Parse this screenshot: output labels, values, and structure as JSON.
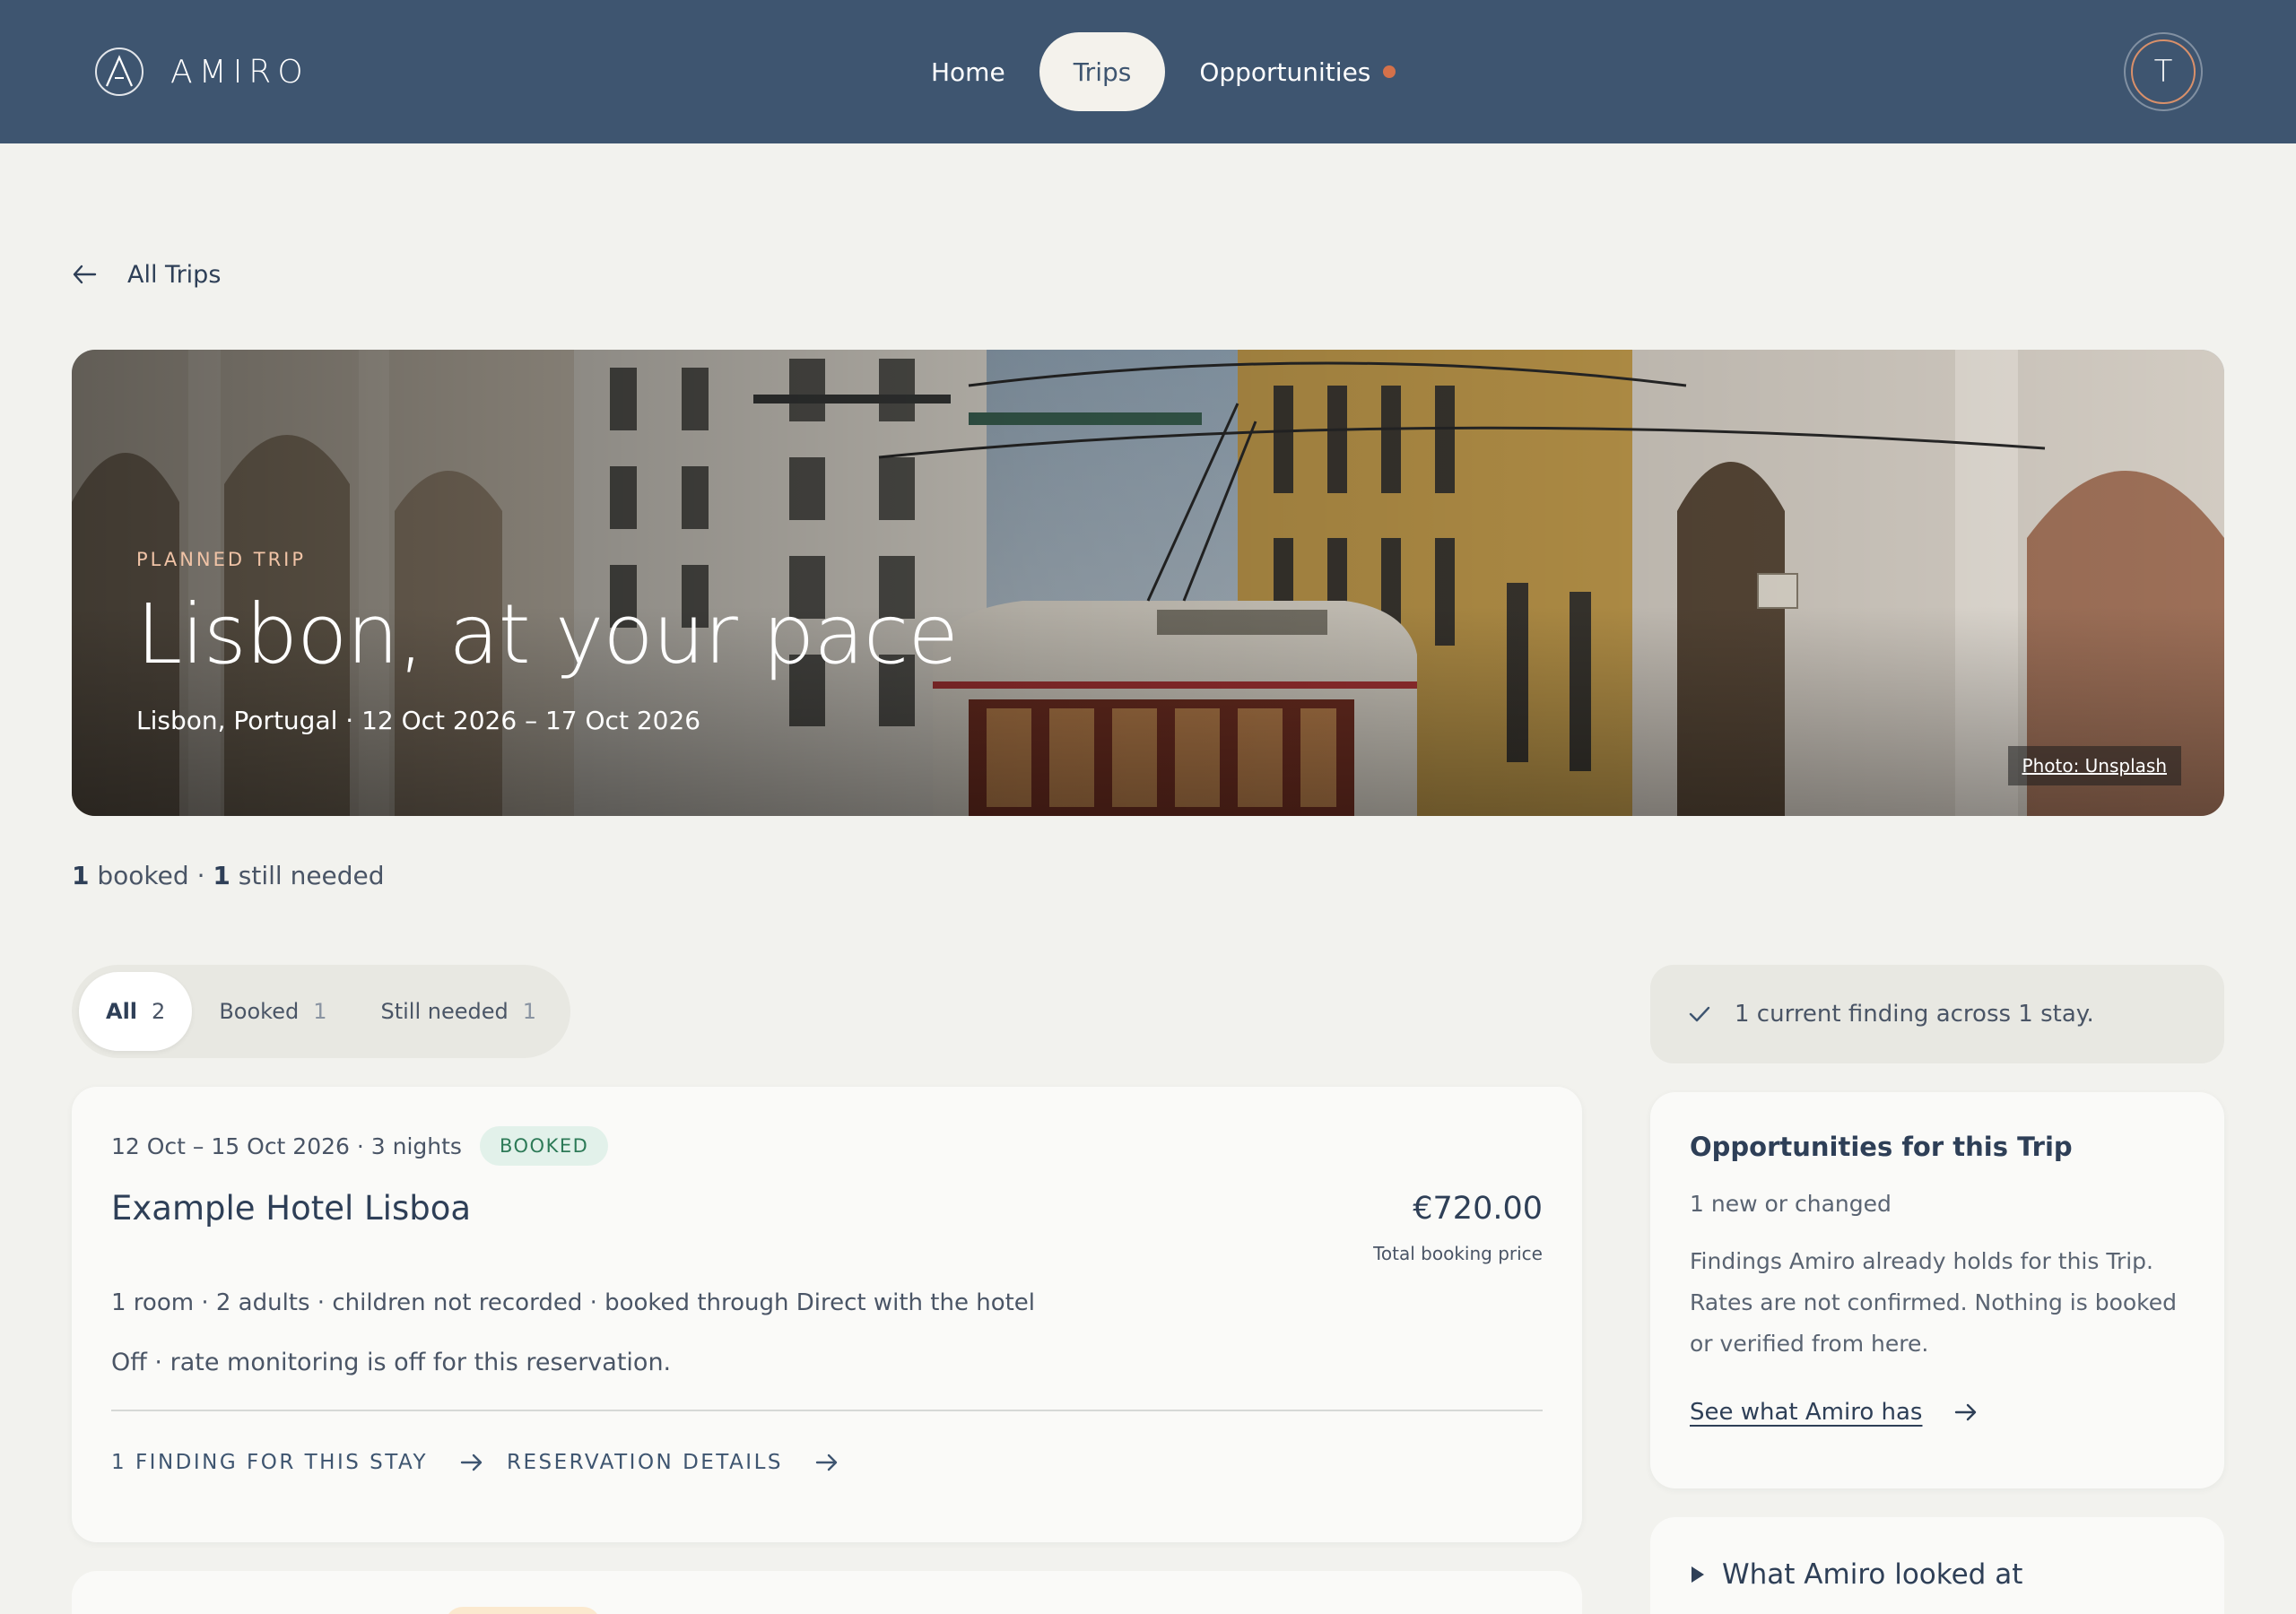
{
  "brand": {
    "name": "AMIRO"
  },
  "nav": {
    "items": [
      {
        "label": "Home",
        "active": false
      },
      {
        "label": "Trips",
        "active": true
      },
      {
        "label": "Opportunities",
        "active": false,
        "has_notification": true
      }
    ],
    "notification_color": "#d4714a"
  },
  "user": {
    "initial": "T"
  },
  "back": {
    "label": "All Trips",
    "icon": "arrow-left-icon"
  },
  "hero": {
    "eyebrow": "PLANNED TRIP",
    "title": "Lisbon, at your pace",
    "subtitle": "Lisbon, Portugal · 12 Oct 2026 – 17 Oct 2026",
    "photo_credit": "Photo: Unsplash"
  },
  "summary": {
    "booked_count": "1",
    "booked_label": "booked",
    "separator": "·",
    "needed_count": "1",
    "needed_label": "still needed"
  },
  "filters": [
    {
      "label": "All",
      "count": "2",
      "active": true
    },
    {
      "label": "Booked",
      "count": "1",
      "active": false
    },
    {
      "label": "Still needed",
      "count": "1",
      "active": false
    }
  ],
  "booking": {
    "dates": "12 Oct – 15 Oct 2026 · 3 nights",
    "status": "BOOKED",
    "hotel": "Example Hotel Lisboa",
    "price": "€720.00",
    "price_label": "Total booking price",
    "details": "1 room · 2 adults · children not recorded · booked through Direct with the hotel",
    "monitoring": "Off · rate monitoring is off for this reservation.",
    "actions": {
      "findings": "1 FINDING FOR THIS STAY",
      "reservation": "RESERVATION DETAILS"
    }
  },
  "sidebar": {
    "finding_banner": "1 current finding across 1 stay.",
    "opportunities": {
      "title": "Opportunities for this Trip",
      "subtitle": "1 new or changed",
      "body": "Findings Amiro already holds for this Trip. Rates are not confirmed. Nothing is booked or verified from here.",
      "link": "See what Amiro has"
    },
    "looked_at": {
      "label": "What Amiro looked at"
    }
  },
  "colors": {
    "topbar": "#3e5570",
    "background": "#f2f2ee",
    "booked_badge_bg": "#e2f1ea",
    "booked_badge_text": "#2d7a57",
    "accent": "#d9906a"
  }
}
